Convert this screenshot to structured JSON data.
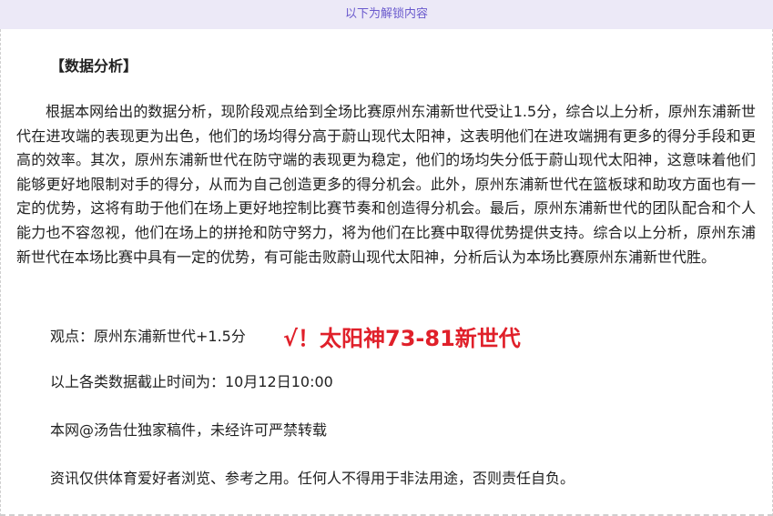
{
  "banner": {
    "text": "以下为解锁内容"
  },
  "article": {
    "section_title": "【数据分析】",
    "analysis_text": "根据本网给出的数据分析，现阶段观点给到全场比赛原州东浦新世代受让1.5分，综合以上分析，原州东浦新世代在进攻端的表现更为出色，他们的场均得分高于蔚山现代太阳神，这表明他们在进攻端拥有更多的得分手段和更高的效率。其次，原州东浦新世代在防守端的表现更为稳定，他们的场均失分低于蔚山现代太阳神，这意味着他们能够更好地限制对手的得分，从而为自己创造更多的得分机会。此外，原州东浦新世代在篮板球和助攻方面也有一定的优势，这将有助于他们在场上更好地控制比赛节奏和创造得分机会。最后，原州东浦新世代的团队配合和个人能力也不容忽视，他们在场上的拼抢和防守努力，将为他们在比赛中取得优势提供支持。综合以上分析，原州东浦新世代在本场比赛中具有一定的优势，有可能击败蔚山现代太阳神，分析后认为本场比赛原州东浦新世代胜。",
    "view_label": "观点：原州东浦新世代+1.5分",
    "result_mark": "√！太阳神73-81新世代",
    "cutoff_time": "以上各类数据截止时间为：10月12日10:00",
    "copyright": "本网@汤告仕独家稿件，未经许可严禁转载",
    "disclaimer": "资讯仅供体育爱好者浏览、参考之用。任何人不得用于非法用途，否则责任自负。"
  },
  "colors": {
    "banner_background": "#ece9f7",
    "banner_text": "#6a5acd",
    "result_mark": "#e0202a",
    "body_text": "#222222"
  }
}
